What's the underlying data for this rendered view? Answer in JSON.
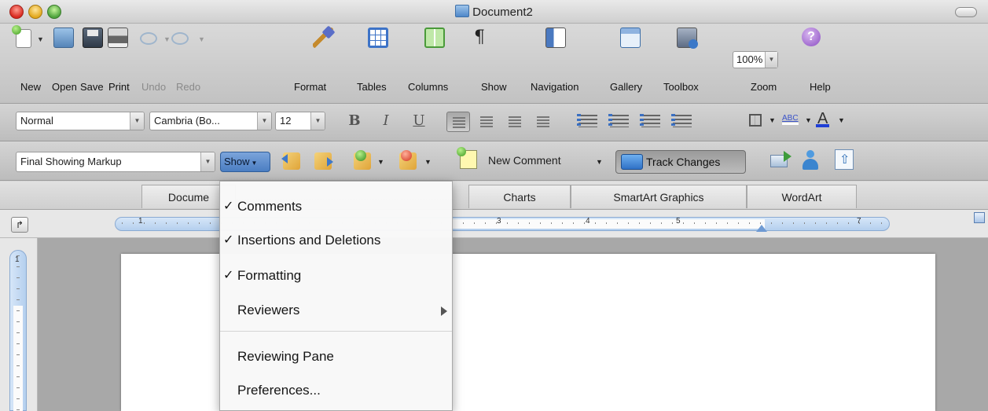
{
  "window": {
    "title": "Document2"
  },
  "toolbar": {
    "new_label": "New",
    "open_label": "Open",
    "save_label": "Save",
    "print_label": "Print",
    "undo_label": "Undo",
    "redo_label": "Redo",
    "format_label": "Format",
    "tables_label": "Tables",
    "columns_label": "Columns",
    "show_label": "Show",
    "navigation_label": "Navigation",
    "gallery_label": "Gallery",
    "toolbox_label": "Toolbox",
    "zoom_label": "Zoom",
    "help_label": "Help",
    "zoom_value": "100%",
    "show_glyph": "¶",
    "help_glyph": "?"
  },
  "formatting": {
    "style_value": "Normal",
    "font_value": "Cambria (Bo...",
    "size_value": "12",
    "bold": "B",
    "italic": "I",
    "underline": "U",
    "abc": "ABC",
    "font_color_glyph": "A"
  },
  "reviewing": {
    "markup_value": "Final Showing Markup",
    "show_button": "Show",
    "new_comment": "New Comment",
    "track_changes": "Track Changes"
  },
  "tabs": [
    {
      "label": "Docume"
    },
    {
      "label": "Charts"
    },
    {
      "label": "SmartArt Graphics"
    },
    {
      "label": "WordArt"
    }
  ],
  "ruler": {
    "numbers": [
      "1",
      "3",
      "4",
      "5",
      "7"
    ],
    "vertical_number": "1"
  },
  "show_menu": {
    "items": [
      {
        "label": "Comments",
        "checked": "✓"
      },
      {
        "label": "Insertions and Deletions",
        "checked": "✓"
      },
      {
        "label": "Formatting",
        "checked": "✓"
      },
      {
        "label": "Reviewers",
        "checked": ""
      },
      {
        "label": "Reviewing Pane",
        "checked": ""
      },
      {
        "label": "Preferences...",
        "checked": ""
      }
    ]
  },
  "colors": {
    "show_button_blue": "#4b7ec2",
    "font_color_underline": "#1f3fd6"
  }
}
